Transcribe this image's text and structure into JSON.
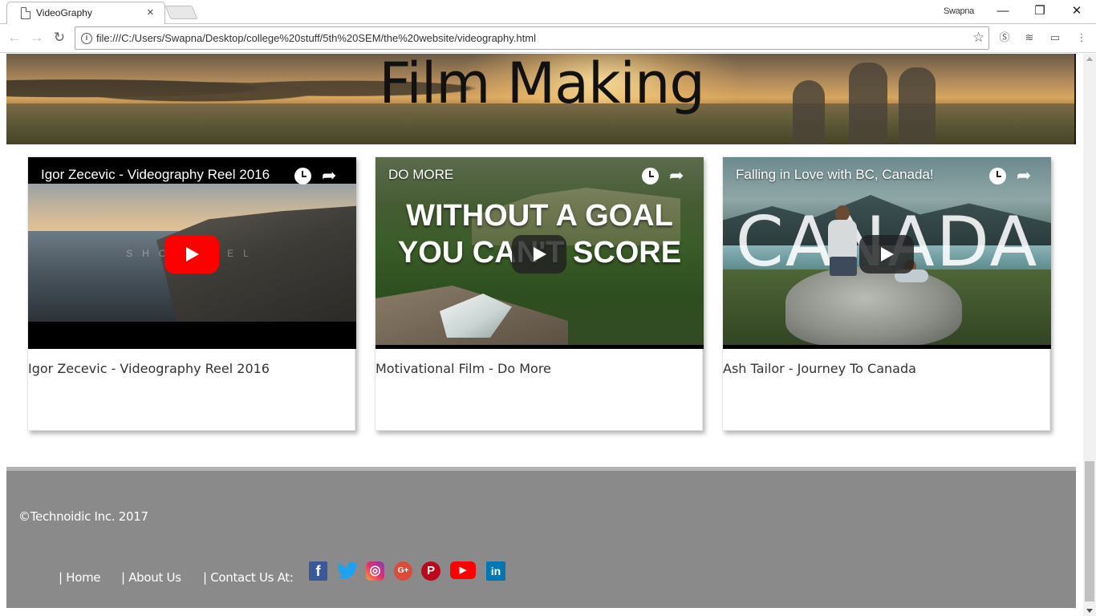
{
  "browser": {
    "tab_title": "VideoGraphy",
    "tab_close": "×",
    "profile_name": "Swapna",
    "minimize": "—",
    "restore": "❐",
    "close": "✕",
    "back": "←",
    "forward": "→",
    "reload": "↻",
    "url": "file:///C:/Users/Swapna/Desktop/college%20stuff/5th%20SEM/the%20website/videography.html",
    "bookmark_star": "☆",
    "menu": "⋮"
  },
  "banner": {
    "title": "Film Making"
  },
  "videos": [
    {
      "overlay_title": "Igor Zecevic - Videography Reel 2016",
      "background_text": "SHOWREEL",
      "caption": "Igor Zecevic - Videography Reel 2016",
      "play_style": "red"
    },
    {
      "overlay_title": "DO MORE",
      "headline_line1": "WITHOUT A GOAL",
      "headline_line2": "YOU CAN'T SCORE",
      "caption": "Motivational Film - Do More",
      "play_style": "dark"
    },
    {
      "overlay_title": "Falling in Love with BC, Canada!",
      "background_text": "CANADA",
      "caption": "Ash Tailor - Journey To Canada",
      "play_style": "dark"
    }
  ],
  "video_controls": {
    "watch_later_icon": "clock-icon",
    "share_icon": "share-icon",
    "share_glyph": "➦"
  },
  "footer": {
    "copyright": "©Technoidic Inc. 2017",
    "links": [
      "| Home",
      "| About Us",
      "| Contact Us At:"
    ],
    "social": [
      {
        "name": "facebook",
        "glyph": "f",
        "color": "#3b5998"
      },
      {
        "name": "twitter",
        "glyph": "🐦",
        "color": "#1da1f2"
      },
      {
        "name": "instagram",
        "glyph": "◎",
        "color": "#c13584"
      },
      {
        "name": "google-plus",
        "glyph": "G+",
        "color": "#dd4b39"
      },
      {
        "name": "pinterest",
        "glyph": "P",
        "color": "#bd081c"
      },
      {
        "name": "youtube",
        "glyph": "▶",
        "color": "#ff0000"
      },
      {
        "name": "linkedin",
        "glyph": "in",
        "color": "#0077b5"
      }
    ]
  }
}
